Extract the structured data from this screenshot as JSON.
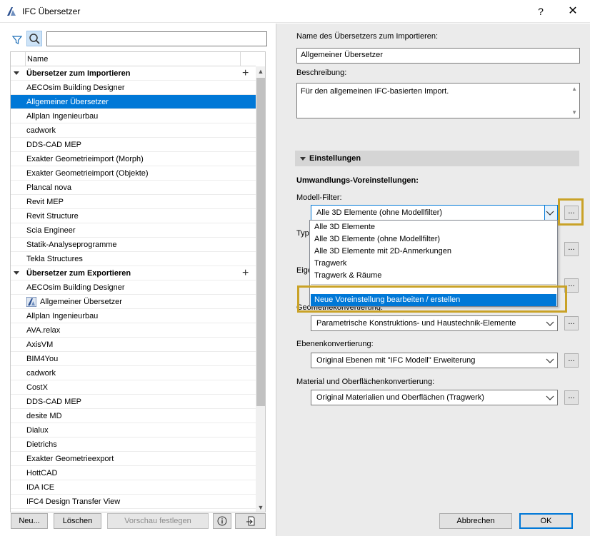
{
  "window": {
    "title": "IFC Übersetzer",
    "help_label": "?",
    "close_label": "✕"
  },
  "left": {
    "search": {
      "value": "",
      "placeholder": ""
    },
    "column_header": "Name",
    "rows": [
      {
        "type": "group",
        "label": "Übersetzer zum Importieren"
      },
      {
        "type": "item",
        "label": "AECOsim Building Designer"
      },
      {
        "type": "item",
        "label": "Allgemeiner Übersetzer",
        "selected": true
      },
      {
        "type": "item",
        "label": "Allplan Ingenieurbau"
      },
      {
        "type": "item",
        "label": "cadwork"
      },
      {
        "type": "item",
        "label": "DDS-CAD MEP"
      },
      {
        "type": "item",
        "label": "Exakter Geometrieimport (Morph)"
      },
      {
        "type": "item",
        "label": "Exakter Geometrieimport (Objekte)"
      },
      {
        "type": "item",
        "label": "Plancal nova"
      },
      {
        "type": "item",
        "label": "Revit MEP"
      },
      {
        "type": "item",
        "label": "Revit Structure"
      },
      {
        "type": "item",
        "label": "Scia Engineer"
      },
      {
        "type": "item",
        "label": "Statik-Analyseprogramme"
      },
      {
        "type": "item",
        "label": "Tekla Structures"
      },
      {
        "type": "group",
        "label": "Übersetzer zum Exportieren"
      },
      {
        "type": "item",
        "label": "AECOsim Building Designer"
      },
      {
        "type": "item",
        "label": "Allgemeiner Übersetzer",
        "icon": "archicad-icon"
      },
      {
        "type": "item",
        "label": "Allplan Ingenieurbau"
      },
      {
        "type": "item",
        "label": "AVA.relax"
      },
      {
        "type": "item",
        "label": "AxisVM"
      },
      {
        "type": "item",
        "label": "BIM4You"
      },
      {
        "type": "item",
        "label": "cadwork"
      },
      {
        "type": "item",
        "label": "CostX"
      },
      {
        "type": "item",
        "label": "DDS-CAD MEP"
      },
      {
        "type": "item",
        "label": "desite MD"
      },
      {
        "type": "item",
        "label": "Dialux"
      },
      {
        "type": "item",
        "label": "Dietrichs"
      },
      {
        "type": "item",
        "label": "Exakter Geometrieexport"
      },
      {
        "type": "item",
        "label": "HottCAD"
      },
      {
        "type": "item",
        "label": "IDA ICE"
      },
      {
        "type": "item",
        "label": "IFC4 Design Transfer View"
      }
    ],
    "buttons": {
      "new": "Neu...",
      "delete": "Löschen",
      "set_preview": "Vorschau festlegen"
    }
  },
  "right": {
    "name_label": "Name des Übersetzers zum Importieren:",
    "name_value": "Allgemeiner Übersetzer",
    "desc_label": "Beschreibung:",
    "desc_value": "Für den allgemeinen IFC-basierten Import.",
    "section_title": "Einstellungen",
    "conversion_heading": "Umwandlungs-Voreinstellungen:",
    "model_filter_label": "Modell-Filter:",
    "model_filter_value": "Alle 3D Elemente (ohne Modellfilter)",
    "type_label_partial": "Typ-",
    "props_label_partial": "Eige",
    "geometry_label": "Geometriekonvertierung:",
    "geometry_value": "Parametrische Konstruktions- und Haustechnik-Elemente",
    "layers_label": "Ebenenkonvertierung:",
    "layers_value": "Original Ebenen mit \"IFC Modell\" Erweiterung",
    "material_label": "Material und Oberflächenkonvertierung:",
    "material_value": "Original Materialien und Oberflächen (Tragwerk)",
    "dots_label": "...",
    "dropdown": {
      "options": [
        "Alle 3D Elemente",
        "Alle 3D Elemente (ohne Modellfilter)",
        "Alle 3D Elemente mit 2D-Anmerkungen",
        "Tragwerk",
        "Tragwerk & Räume"
      ],
      "edit_option": "Neue Voreinstellung bearbeiten / erstellen"
    },
    "cancel_label": "Abbrechen",
    "ok_label": "OK"
  },
  "colors": {
    "selection": "#0078d7",
    "highlight": "#c9a227",
    "panel": "#ebebeb"
  }
}
